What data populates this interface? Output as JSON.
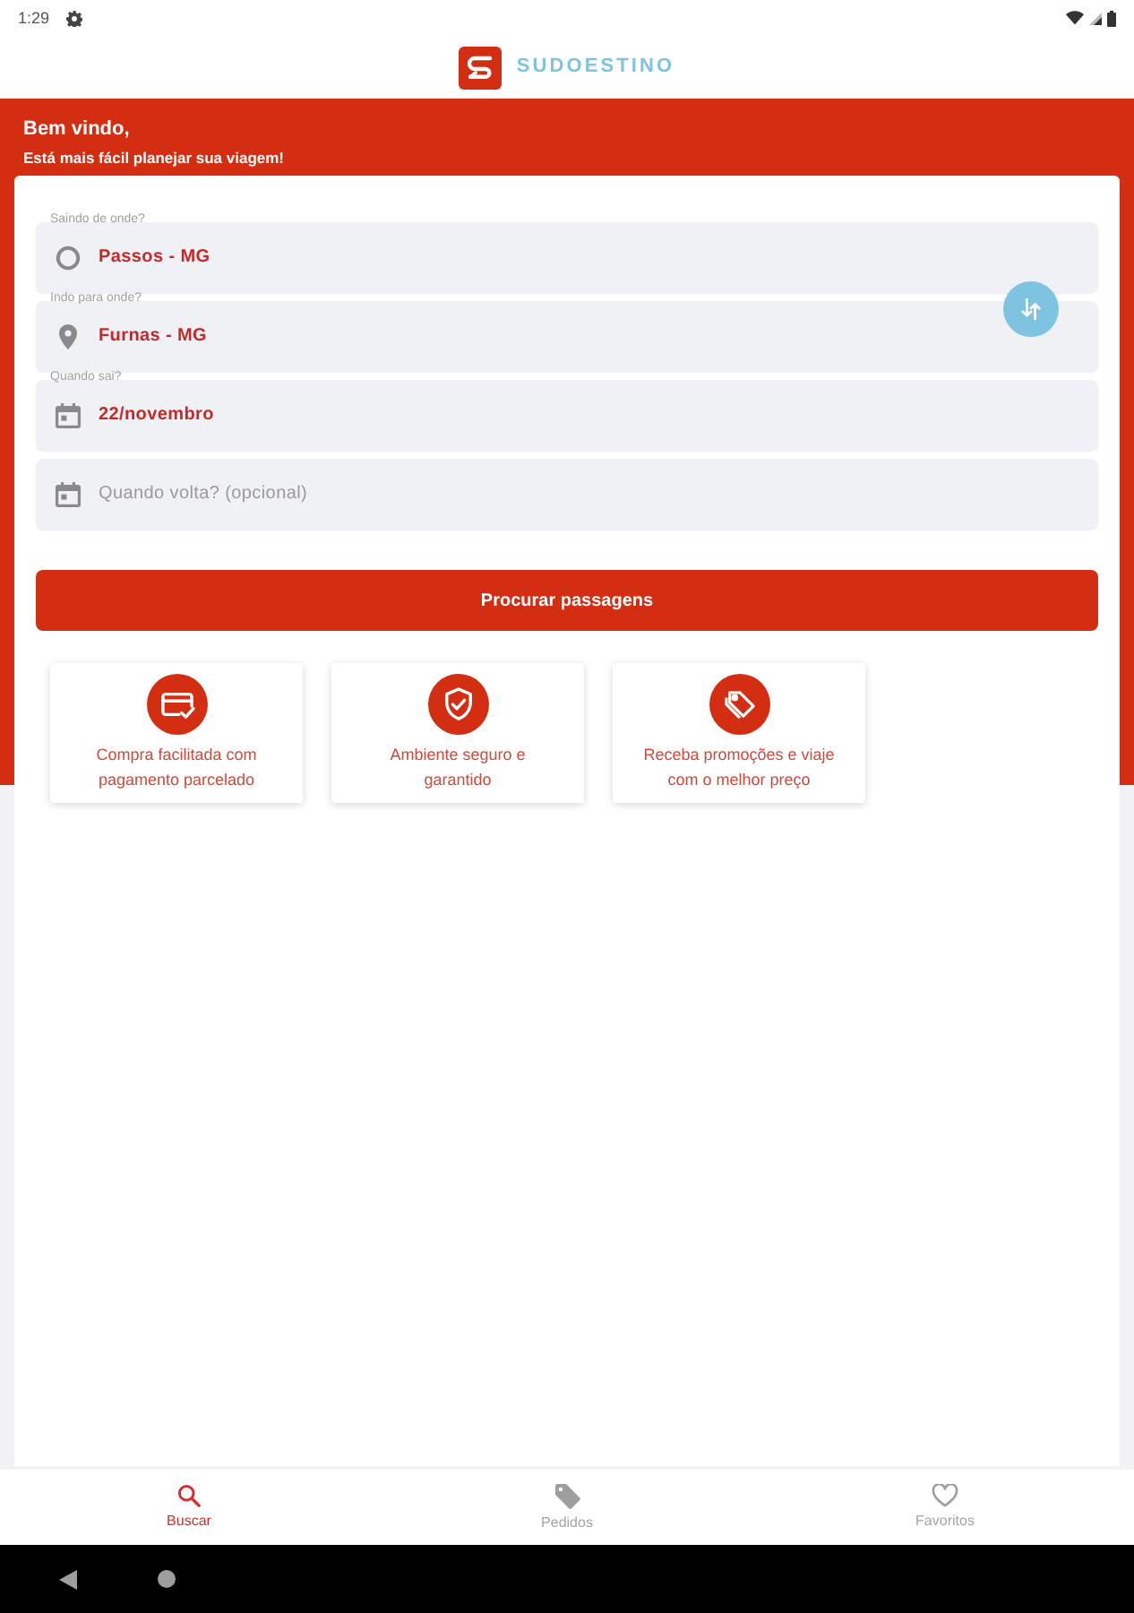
{
  "status_bar": {
    "time": "1:29"
  },
  "header": {
    "brand": "SUDOESTINO"
  },
  "welcome": {
    "title": "Bem vindo,",
    "subtitle": "Está mais fácil planejar sua viagem!"
  },
  "search_form": {
    "fields": [
      {
        "kind": "origin",
        "label": "Saindo de onde?",
        "value": "Passos - MG"
      },
      {
        "kind": "destination",
        "label": "Indo para onde?",
        "value": "Furnas - MG"
      },
      {
        "kind": "date",
        "label": "Quando sai?",
        "value": "22/novembro"
      },
      {
        "kind": "date",
        "placeholder": "Quando volta? (opcional)"
      }
    ],
    "submit": "Procurar passagens"
  },
  "features": [
    {
      "kind": "payment",
      "text": "Compra facilitada com pagamento parcelado"
    },
    {
      "kind": "security",
      "text": "Ambiente seguro e garantido"
    },
    {
      "kind": "promotion",
      "text": "Receba promoções e viaje com o melhor preço"
    }
  ],
  "bottom_nav": [
    {
      "kind": "search",
      "label": "Buscar",
      "selected": true
    },
    {
      "kind": "tag",
      "label": "Pedidos",
      "selected": false
    },
    {
      "kind": "heart",
      "label": "Favoritos",
      "selected": false
    }
  ]
}
